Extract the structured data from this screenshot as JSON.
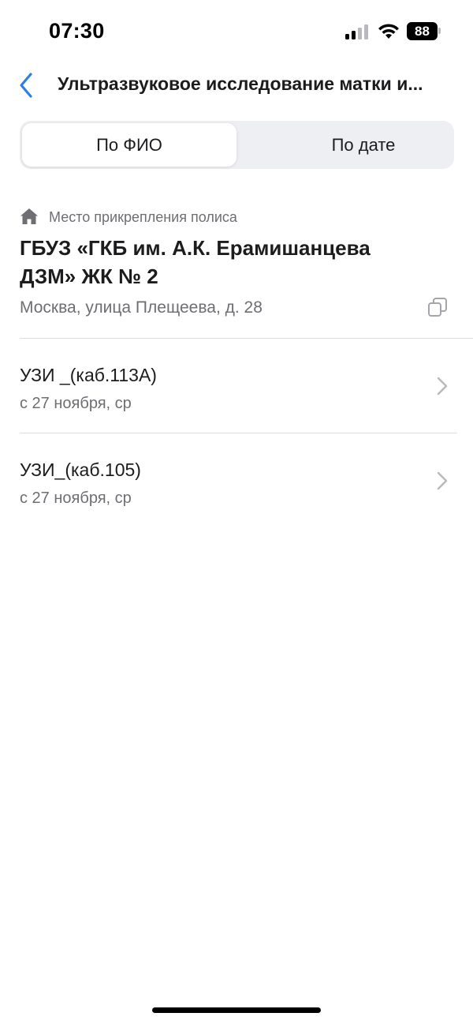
{
  "status_bar": {
    "time": "07:30",
    "battery": "88"
  },
  "header": {
    "title": "Ультразвуковое исследование матки и..."
  },
  "tabs": [
    {
      "label": "По ФИО",
      "active": true
    },
    {
      "label": "По дате",
      "active": false
    }
  ],
  "clinic": {
    "policy_label": "Место прикрепления полиса",
    "name": "ГБУЗ «ГКБ им. А.К. Ерамишанцева ДЗМ» ЖК № 2",
    "address": "Москва, улица Плещеева, д. 28"
  },
  "rooms": [
    {
      "title": "УЗИ _(каб.113А)",
      "subtitle": "с 27 ноября, ср"
    },
    {
      "title": "УЗИ_(каб.105)",
      "subtitle": "с 27 ноября, ср"
    }
  ],
  "colors": {
    "accent": "#2f7fe0",
    "secondary_text": "#6e6e73",
    "segment_bg": "#eeeff3",
    "divider": "#dedee2"
  },
  "icons": [
    "cellular-signal-icon",
    "wifi-icon",
    "battery-icon",
    "back-chevron-icon",
    "home-icon",
    "copy-icon",
    "chevron-right-icon"
  ]
}
